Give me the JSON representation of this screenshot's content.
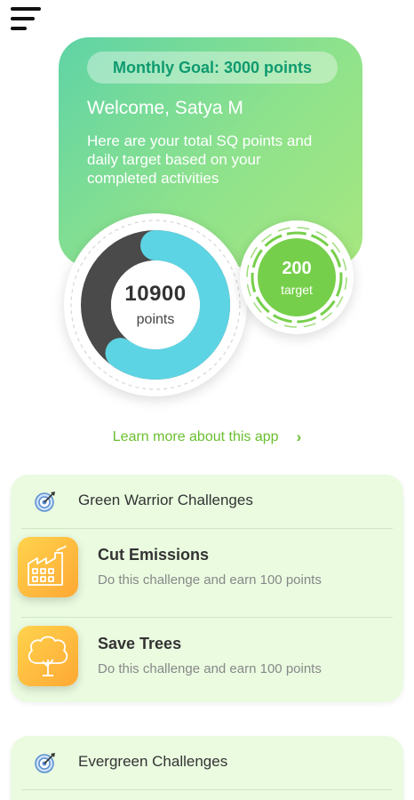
{
  "hero": {
    "goal": "Monthly Goal: 3000 points",
    "welcome": "Welcome, Satya M",
    "description": "Here are your total SQ points and daily target based on your completed activities"
  },
  "points": {
    "value": "10900",
    "label": "points",
    "progress_fraction": 0.6
  },
  "target": {
    "value": "200",
    "label": "target"
  },
  "learn_more": "Learn more about this app",
  "green_warrior": {
    "title": "Green Warrior Challenges",
    "challenges": [
      {
        "title": "Cut Emissions",
        "description": "Do this challenge and earn 100 points",
        "icon": "factory-icon"
      },
      {
        "title": "Save Trees",
        "description": "Do this challenge and earn 100 points",
        "icon": "tree-icon"
      }
    ]
  },
  "evergreen": {
    "title": "Evergreen Challenges"
  },
  "colors": {
    "hero_gradient_start": "#5fd3a6",
    "hero_gradient_end": "#a7e77f",
    "goal_text": "#0f9a6f",
    "ring_progress": "#5dd4e3",
    "ring_track": "#4a4a4a",
    "target_fill": "#76cf4a",
    "link": "#6abf2e",
    "card_bg": "#eafbe0",
    "icon_gradient_start": "#ffd34d",
    "icon_gradient_end": "#ffa834"
  }
}
